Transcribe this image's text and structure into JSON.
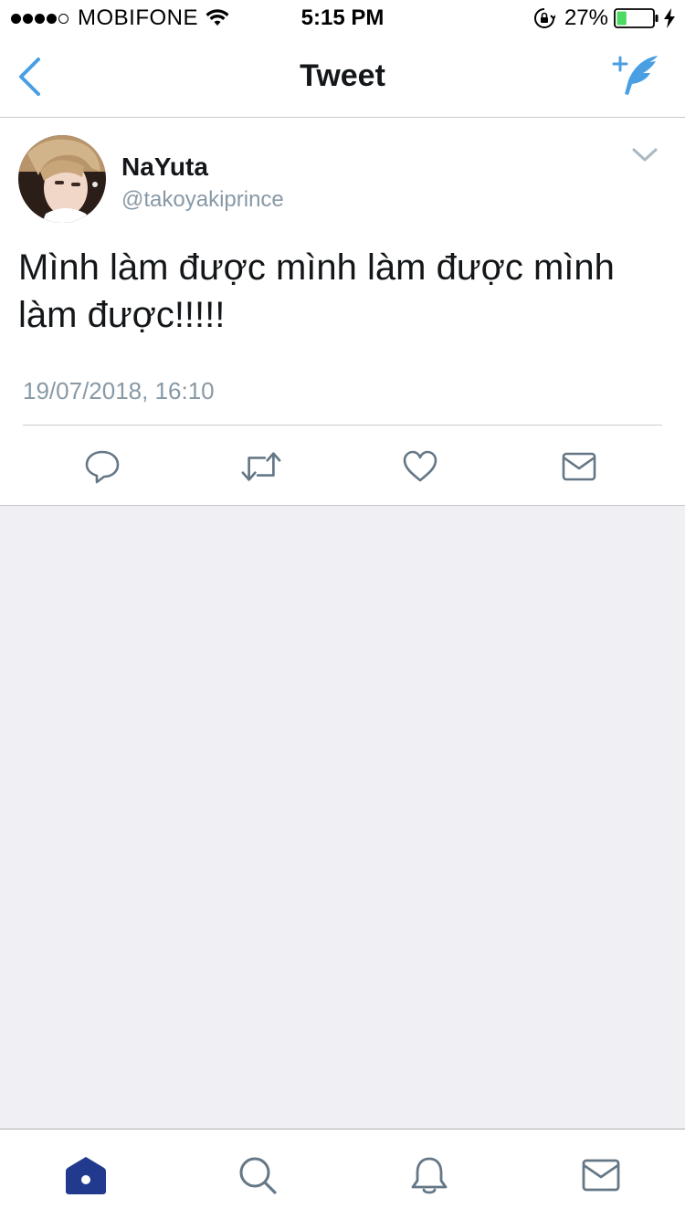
{
  "status_bar": {
    "carrier": "MOBIFONE",
    "time": "5:15 PM",
    "battery_percent": "27%",
    "signal_bars_filled": 4,
    "signal_bars_total": 5,
    "battery_level": 0.27
  },
  "nav": {
    "title": "Tweet",
    "back_icon": "chevron-left-icon",
    "compose_icon": "compose-tweet-icon"
  },
  "tweet": {
    "user_name": "NaYuta",
    "user_handle": "@takoyakiprince",
    "text": "Mình làm được mình làm được mình làm được!!!!!",
    "timestamp": "19/07/2018, 16:10",
    "actions": [
      "reply-icon",
      "retweet-icon",
      "like-icon",
      "direct-message-icon"
    ]
  },
  "tab_bar": {
    "tabs": [
      "home-icon",
      "search-icon",
      "notifications-icon",
      "messages-icon"
    ],
    "active": "home"
  },
  "colors": {
    "accent": "#4a9fe3",
    "text_primary": "#14171a",
    "text_secondary": "#8899a6",
    "icon_gray": "#657786",
    "home_active": "#223a8e",
    "background_empty": "#efeff4",
    "battery_green": "#4cd964"
  }
}
